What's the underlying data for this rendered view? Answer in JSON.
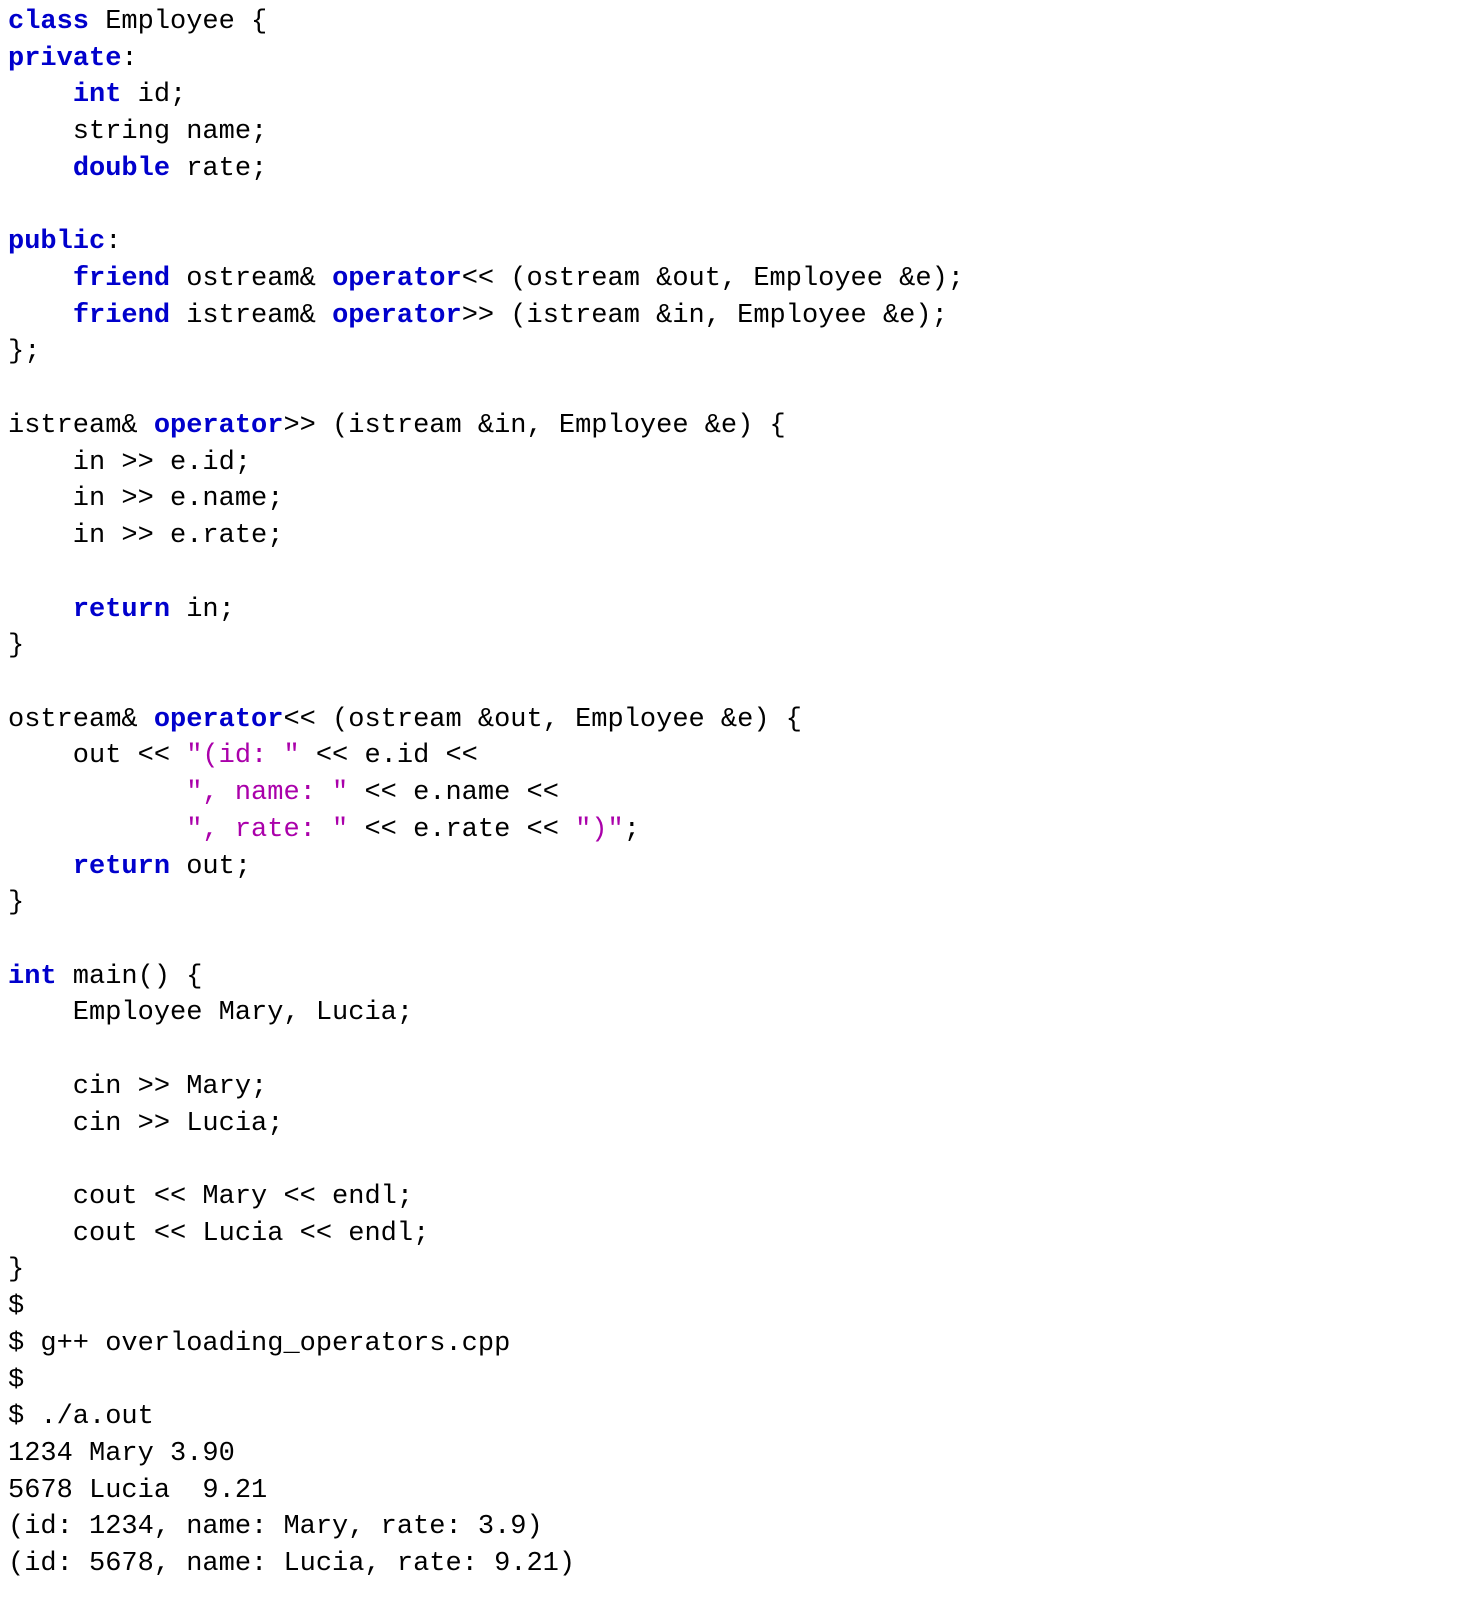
{
  "code_lines": [
    {
      "segments": [
        {
          "t": "class",
          "c": "kw"
        },
        {
          "t": " Employee {"
        }
      ]
    },
    {
      "segments": [
        {
          "t": "private",
          "c": "kw"
        },
        {
          "t": ":"
        }
      ]
    },
    {
      "segments": [
        {
          "t": "    "
        },
        {
          "t": "int",
          "c": "kw"
        },
        {
          "t": " id;"
        }
      ]
    },
    {
      "segments": [
        {
          "t": "    string name;"
        }
      ]
    },
    {
      "segments": [
        {
          "t": "    "
        },
        {
          "t": "double",
          "c": "kw"
        },
        {
          "t": " rate;"
        }
      ]
    },
    {
      "segments": [
        {
          "t": ""
        }
      ]
    },
    {
      "segments": [
        {
          "t": "public",
          "c": "kw"
        },
        {
          "t": ":"
        }
      ]
    },
    {
      "segments": [
        {
          "t": "    "
        },
        {
          "t": "friend",
          "c": "kw"
        },
        {
          "t": " ostream& "
        },
        {
          "t": "operator",
          "c": "kw"
        },
        {
          "t": "<< (ostream &out, Employee &e);"
        }
      ]
    },
    {
      "segments": [
        {
          "t": "    "
        },
        {
          "t": "friend",
          "c": "kw"
        },
        {
          "t": " istream& "
        },
        {
          "t": "operator",
          "c": "kw"
        },
        {
          "t": ">> (istream &in, Employee &e);"
        }
      ]
    },
    {
      "segments": [
        {
          "t": "};"
        }
      ]
    },
    {
      "segments": [
        {
          "t": ""
        }
      ]
    },
    {
      "segments": [
        {
          "t": "istream& "
        },
        {
          "t": "operator",
          "c": "kw"
        },
        {
          "t": ">> (istream &in, Employee &e) {"
        }
      ]
    },
    {
      "segments": [
        {
          "t": "    in >> e.id;"
        }
      ]
    },
    {
      "segments": [
        {
          "t": "    in >> e.name;"
        }
      ]
    },
    {
      "segments": [
        {
          "t": "    in >> e.rate;"
        }
      ]
    },
    {
      "segments": [
        {
          "t": ""
        }
      ]
    },
    {
      "segments": [
        {
          "t": "    "
        },
        {
          "t": "return",
          "c": "kw"
        },
        {
          "t": " in;"
        }
      ]
    },
    {
      "segments": [
        {
          "t": "}"
        }
      ]
    },
    {
      "segments": [
        {
          "t": ""
        }
      ]
    },
    {
      "segments": [
        {
          "t": "ostream& "
        },
        {
          "t": "operator",
          "c": "kw"
        },
        {
          "t": "<< (ostream &out, Employee &e) {"
        }
      ]
    },
    {
      "segments": [
        {
          "t": "    out << "
        },
        {
          "t": "\"(id: \"",
          "c": "str"
        },
        {
          "t": " << e.id <<"
        }
      ]
    },
    {
      "segments": [
        {
          "t": "           "
        },
        {
          "t": "\", name: \"",
          "c": "str"
        },
        {
          "t": " << e.name <<"
        }
      ]
    },
    {
      "segments": [
        {
          "t": "           "
        },
        {
          "t": "\", rate: \"",
          "c": "str"
        },
        {
          "t": " << e.rate << "
        },
        {
          "t": "\")\"",
          "c": "str"
        },
        {
          "t": ";"
        }
      ]
    },
    {
      "segments": [
        {
          "t": "    "
        },
        {
          "t": "return",
          "c": "kw"
        },
        {
          "t": " out;"
        }
      ]
    },
    {
      "segments": [
        {
          "t": "}"
        }
      ]
    },
    {
      "segments": [
        {
          "t": ""
        }
      ]
    },
    {
      "segments": [
        {
          "t": "int",
          "c": "kw"
        },
        {
          "t": " main() {"
        }
      ]
    },
    {
      "segments": [
        {
          "t": "    Employee Mary, Lucia;"
        }
      ]
    },
    {
      "segments": [
        {
          "t": ""
        }
      ]
    },
    {
      "segments": [
        {
          "t": "    cin >> Mary;"
        }
      ]
    },
    {
      "segments": [
        {
          "t": "    cin >> Lucia;"
        }
      ]
    },
    {
      "segments": [
        {
          "t": ""
        }
      ]
    },
    {
      "segments": [
        {
          "t": "    cout << Mary << endl;"
        }
      ]
    },
    {
      "segments": [
        {
          "t": "    cout << Lucia << endl;"
        }
      ]
    },
    {
      "segments": [
        {
          "t": "}"
        }
      ]
    },
    {
      "segments": [
        {
          "t": "$"
        }
      ]
    },
    {
      "segments": [
        {
          "t": "$ g++ overloading_operators.cpp"
        }
      ]
    },
    {
      "segments": [
        {
          "t": "$"
        }
      ]
    },
    {
      "segments": [
        {
          "t": "$ ./a.out"
        }
      ]
    },
    {
      "segments": [
        {
          "t": "1234 Mary 3.90"
        }
      ]
    },
    {
      "segments": [
        {
          "t": "5678 Lucia  9.21"
        }
      ]
    },
    {
      "segments": [
        {
          "t": "(id: 1234, name: Mary, rate: 3.9)"
        }
      ]
    },
    {
      "segments": [
        {
          "t": "(id: 5678, name: Lucia, rate: 9.21)"
        }
      ]
    }
  ]
}
